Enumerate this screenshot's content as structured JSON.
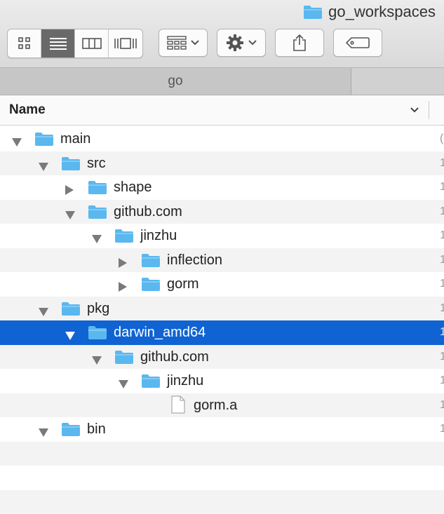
{
  "window": {
    "title": "go_workspaces"
  },
  "toolbar": {
    "view_icons": [
      "icon-view-icon",
      "list-view-icon",
      "column-view-icon",
      "cover-flow-icon"
    ],
    "arrange_icon": "arrange-grid-icon",
    "action_icon": "gear-icon",
    "share_icon": "share-icon",
    "tags_icon": "tag-icon"
  },
  "tabs": [
    {
      "label": "go"
    },
    {
      "label": ""
    }
  ],
  "header": {
    "name_label": "Name"
  },
  "colors": {
    "folder": "#5ab8ef",
    "selection": "#0f63d3",
    "stripe": "#f3f3f3"
  },
  "tree": [
    {
      "name": "main",
      "depth": 0,
      "kind": "folder",
      "expanded": true,
      "clip": "("
    },
    {
      "name": "src",
      "depth": 1,
      "kind": "folder",
      "expanded": true,
      "clip": "1"
    },
    {
      "name": "shape",
      "depth": 2,
      "kind": "folder",
      "expanded": false,
      "clip": "1"
    },
    {
      "name": "github.com",
      "depth": 2,
      "kind": "folder",
      "expanded": true,
      "clip": "1"
    },
    {
      "name": "jinzhu",
      "depth": 3,
      "kind": "folder",
      "expanded": true,
      "clip": "1"
    },
    {
      "name": "inflection",
      "depth": 4,
      "kind": "folder",
      "expanded": false,
      "clip": "1"
    },
    {
      "name": "gorm",
      "depth": 4,
      "kind": "folder",
      "expanded": false,
      "clip": "1"
    },
    {
      "name": "pkg",
      "depth": 1,
      "kind": "folder",
      "expanded": true,
      "clip": "1"
    },
    {
      "name": "darwin_amd64",
      "depth": 2,
      "kind": "folder",
      "expanded": true,
      "selected": true,
      "clip": "1"
    },
    {
      "name": "github.com",
      "depth": 3,
      "kind": "folder",
      "expanded": true,
      "clip": "1"
    },
    {
      "name": "jinzhu",
      "depth": 4,
      "kind": "folder",
      "expanded": true,
      "clip": "1"
    },
    {
      "name": "gorm.a",
      "depth": 5,
      "kind": "file",
      "clip": "1"
    },
    {
      "name": "bin",
      "depth": 1,
      "kind": "folder",
      "expanded": true,
      "clip": "1"
    }
  ]
}
